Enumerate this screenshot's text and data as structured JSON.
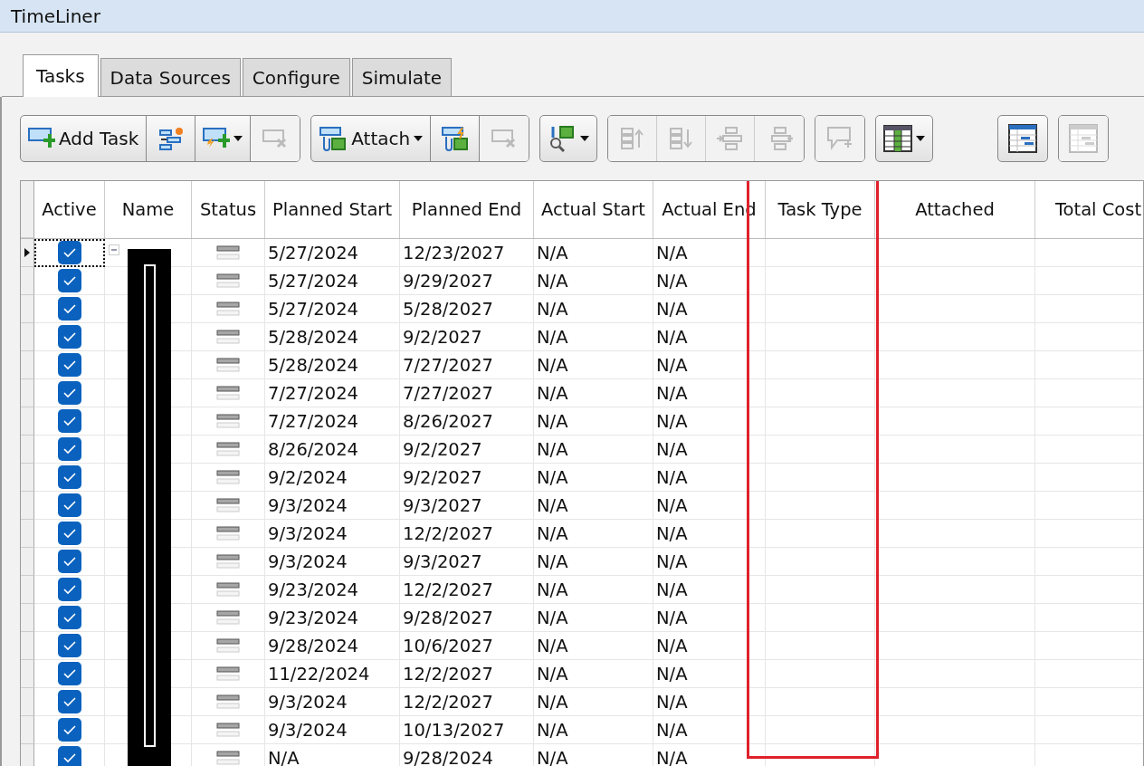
{
  "window": {
    "title": "TimeLiner"
  },
  "tabs": [
    {
      "label": "Tasks",
      "selected": true
    },
    {
      "label": "Data Sources",
      "selected": false
    },
    {
      "label": "Configure",
      "selected": false
    },
    {
      "label": "Simulate",
      "selected": false
    }
  ],
  "toolbar": [
    [
      {
        "kind": "add-task",
        "label": "Add Task",
        "disabled": false,
        "dropdown": false
      },
      {
        "kind": "auto-add",
        "disabled": false,
        "dropdown": false
      },
      {
        "kind": "rule-add",
        "disabled": false,
        "dropdown": true
      },
      {
        "kind": "delete",
        "disabled": true,
        "dropdown": false
      }
    ],
    [
      {
        "kind": "attach",
        "label": "Attach",
        "disabled": false,
        "dropdown": true
      },
      {
        "kind": "auto-attach",
        "disabled": false,
        "dropdown": false
      },
      {
        "kind": "detach",
        "disabled": true,
        "dropdown": false
      }
    ],
    [
      {
        "kind": "find",
        "disabled": false,
        "dropdown": true
      }
    ],
    [
      {
        "kind": "move-up",
        "disabled": true,
        "dropdown": false
      },
      {
        "kind": "move-down",
        "disabled": true,
        "dropdown": false
      },
      {
        "kind": "indent",
        "disabled": true,
        "dropdown": false
      },
      {
        "kind": "outdent",
        "disabled": true,
        "dropdown": false
      }
    ],
    [
      {
        "kind": "comment",
        "disabled": true,
        "dropdown": false
      }
    ],
    [
      {
        "kind": "columns",
        "disabled": false,
        "dropdown": true
      }
    ],
    [
      {
        "kind": "gantt",
        "disabled": false,
        "dropdown": false
      }
    ],
    [
      {
        "kind": "grid-view",
        "disabled": true,
        "dropdown": false
      }
    ]
  ],
  "table": {
    "columns": [
      {
        "label": "Active",
        "highlighted": false
      },
      {
        "label": "Name",
        "highlighted": false
      },
      {
        "label": "Status",
        "highlighted": false
      },
      {
        "label": "Planned Start",
        "highlighted": false
      },
      {
        "label": "Planned End",
        "highlighted": false
      },
      {
        "label": "Actual Start",
        "highlighted": false
      },
      {
        "label": "Actual End",
        "highlighted": false
      },
      {
        "label": "Task Type",
        "highlighted": true
      },
      {
        "label": "Attached",
        "highlighted": false
      },
      {
        "label": "Total Cost",
        "highlighted": false
      }
    ],
    "rows": [
      {
        "selected": true,
        "expanded": true,
        "active": true,
        "planned_start": "5/27/2024",
        "planned_end": "12/23/2027",
        "actual_start": "N/A",
        "actual_end": "N/A"
      },
      {
        "selected": false,
        "active": true,
        "planned_start": "5/27/2024",
        "planned_end": "9/29/2027",
        "actual_start": "N/A",
        "actual_end": "N/A"
      },
      {
        "selected": false,
        "active": true,
        "planned_start": "5/27/2024",
        "planned_end": "5/28/2027",
        "actual_start": "N/A",
        "actual_end": "N/A"
      },
      {
        "selected": false,
        "active": true,
        "planned_start": "5/28/2024",
        "planned_end": "9/2/2027",
        "actual_start": "N/A",
        "actual_end": "N/A"
      },
      {
        "selected": false,
        "active": true,
        "planned_start": "5/28/2024",
        "planned_end": "7/27/2027",
        "actual_start": "N/A",
        "actual_end": "N/A"
      },
      {
        "selected": false,
        "active": true,
        "planned_start": "7/27/2024",
        "planned_end": "7/27/2027",
        "actual_start": "N/A",
        "actual_end": "N/A"
      },
      {
        "selected": false,
        "active": true,
        "planned_start": "7/27/2024",
        "planned_end": "8/26/2027",
        "actual_start": "N/A",
        "actual_end": "N/A"
      },
      {
        "selected": false,
        "active": true,
        "planned_start": "8/26/2024",
        "planned_end": "9/2/2027",
        "actual_start": "N/A",
        "actual_end": "N/A"
      },
      {
        "selected": false,
        "active": true,
        "planned_start": "9/2/2024",
        "planned_end": "9/2/2027",
        "actual_start": "N/A",
        "actual_end": "N/A"
      },
      {
        "selected": false,
        "active": true,
        "planned_start": "9/3/2024",
        "planned_end": "9/3/2027",
        "actual_start": "N/A",
        "actual_end": "N/A"
      },
      {
        "selected": false,
        "active": true,
        "planned_start": "9/3/2024",
        "planned_end": "12/2/2027",
        "actual_start": "N/A",
        "actual_end": "N/A"
      },
      {
        "selected": false,
        "active": true,
        "planned_start": "9/3/2024",
        "planned_end": "9/3/2027",
        "actual_start": "N/A",
        "actual_end": "N/A"
      },
      {
        "selected": false,
        "active": true,
        "planned_start": "9/23/2024",
        "planned_end": "12/2/2027",
        "actual_start": "N/A",
        "actual_end": "N/A"
      },
      {
        "selected": false,
        "active": true,
        "planned_start": "9/23/2024",
        "planned_end": "9/28/2027",
        "actual_start": "N/A",
        "actual_end": "N/A"
      },
      {
        "selected": false,
        "active": true,
        "planned_start": "9/28/2024",
        "planned_end": "10/6/2027",
        "actual_start": "N/A",
        "actual_end": "N/A"
      },
      {
        "selected": false,
        "active": true,
        "planned_start": "11/22/2024",
        "planned_end": "12/2/2027",
        "actual_start": "N/A",
        "actual_end": "N/A"
      },
      {
        "selected": false,
        "active": true,
        "planned_start": "9/3/2024",
        "planned_end": "12/2/2027",
        "actual_start": "N/A",
        "actual_end": "N/A"
      },
      {
        "selected": false,
        "active": true,
        "planned_start": "9/3/2024",
        "planned_end": "10/13/2027",
        "actual_start": "N/A",
        "actual_end": "N/A"
      },
      {
        "selected": false,
        "active": true,
        "planned_start": "N/A",
        "planned_end": "9/28/2024",
        "actual_start": "N/A",
        "actual_end": "N/A"
      }
    ]
  }
}
